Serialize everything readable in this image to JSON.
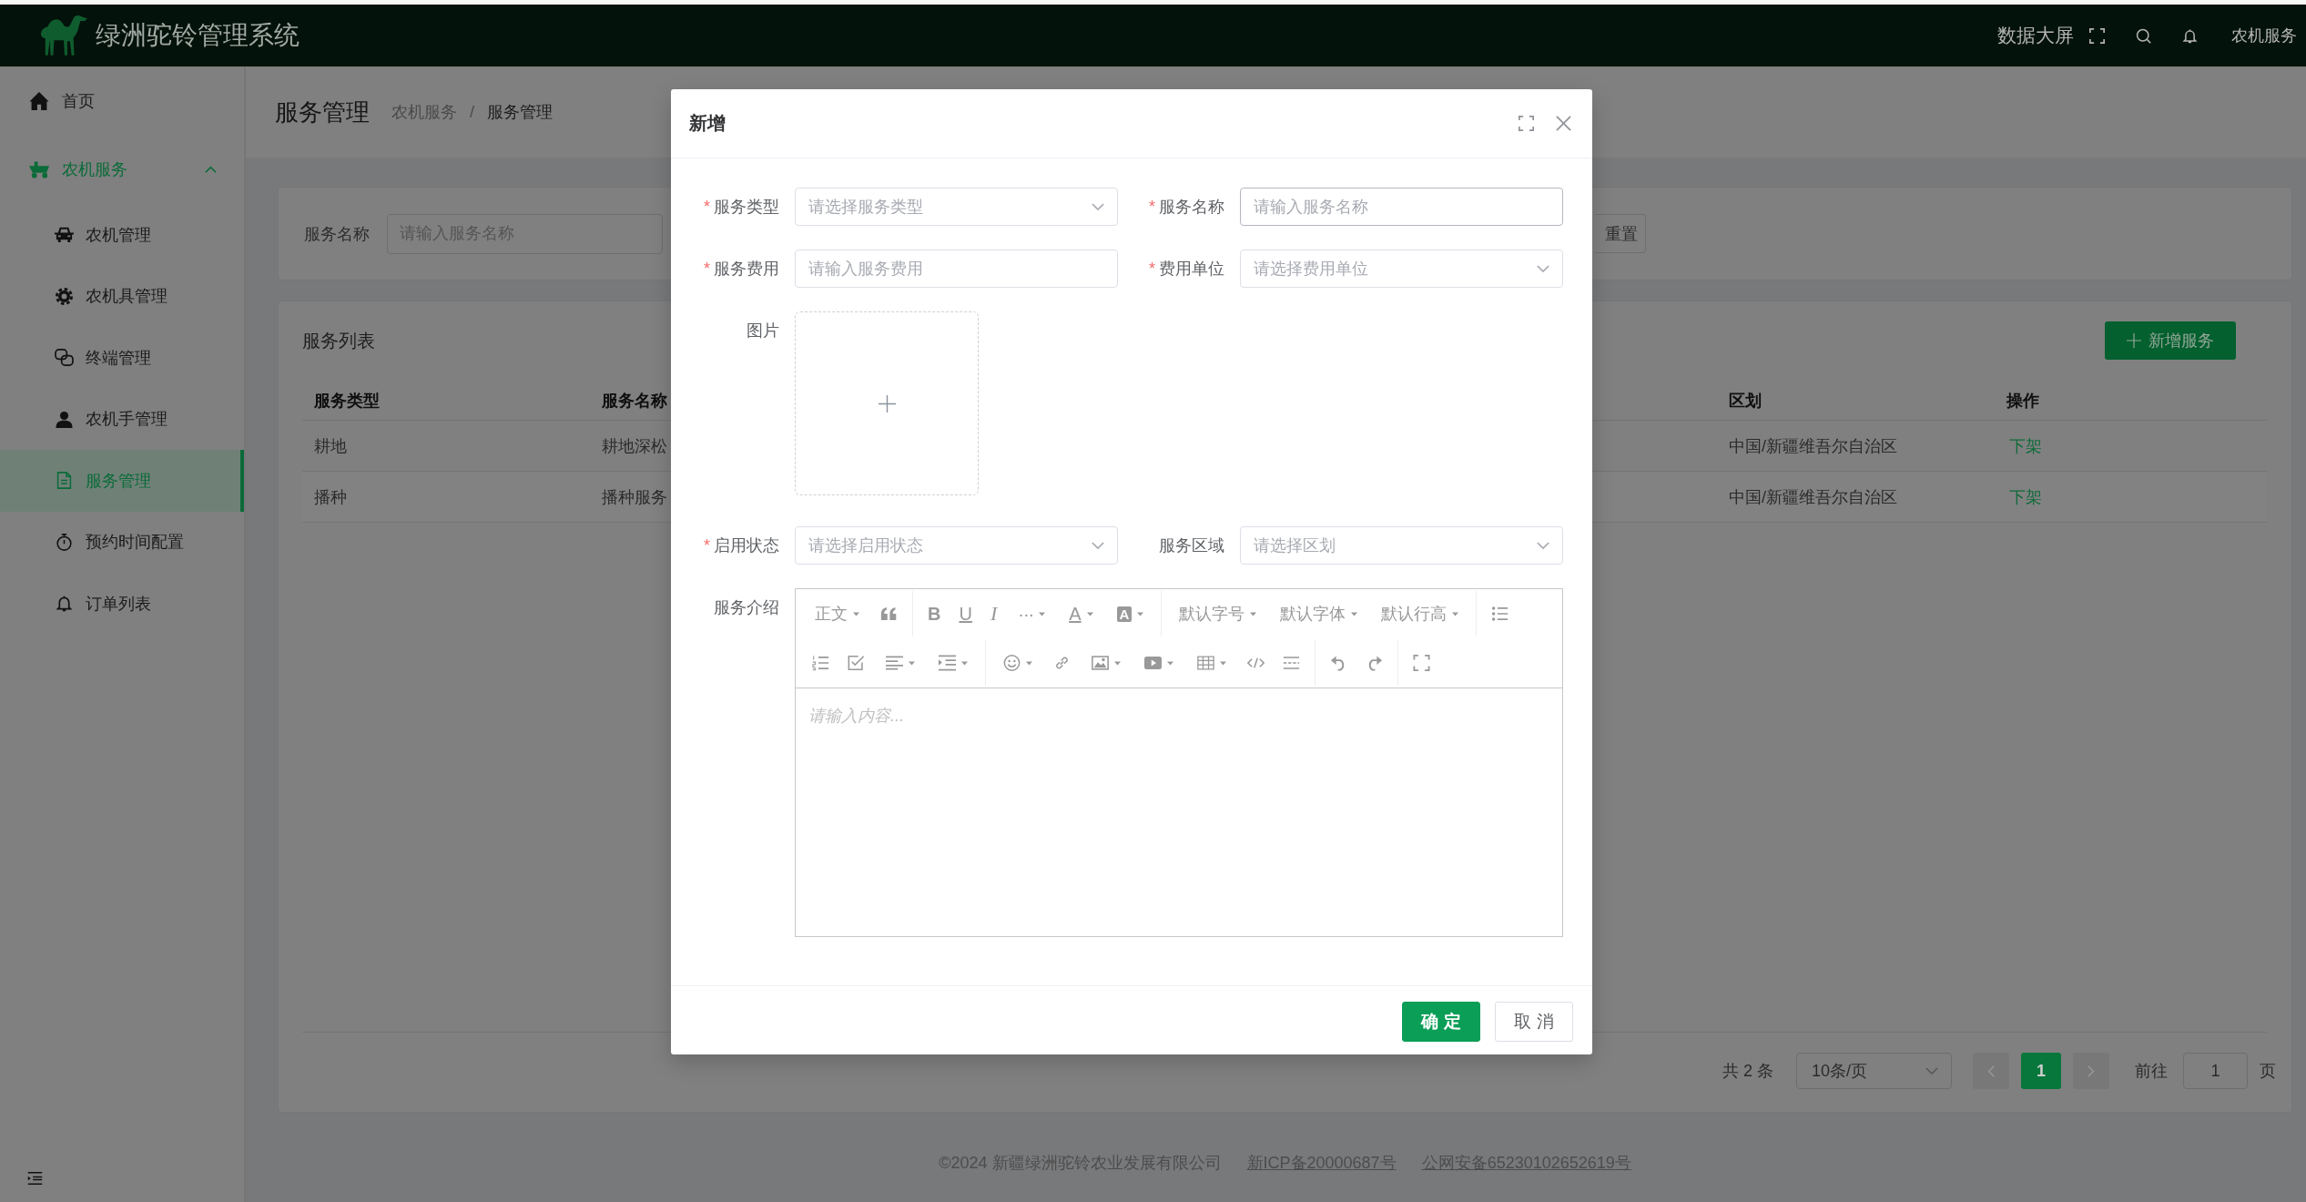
{
  "top_bar": {
    "title": "绿洲驼铃管理系统",
    "links": [
      "数据大屏"
    ],
    "user": "农机服务"
  },
  "sidebar": {
    "items": [
      {
        "label": "首页",
        "selected": false
      },
      {
        "label": "农机服务",
        "selected": false,
        "expanded": true,
        "children": [
          {
            "label": "农机管理",
            "selected": false
          },
          {
            "label": "农机具管理",
            "selected": false
          },
          {
            "label": "终端管理",
            "selected": false
          },
          {
            "label": "农机手管理",
            "selected": false
          },
          {
            "label": "服务管理",
            "selected": true
          },
          {
            "label": "预约时间配置",
            "selected": false
          },
          {
            "label": "订单列表",
            "selected": false
          }
        ]
      }
    ]
  },
  "page_header": {
    "title": "服务管理",
    "breadcrumb": [
      "农机服务",
      "服务管理"
    ],
    "separator": "/"
  },
  "search": {
    "label": "服务名称",
    "placeholder": "请输入服务名称",
    "reset_button": "重置"
  },
  "service_list": {
    "title": "服务列表",
    "add_button": "新增服务",
    "columns": [
      {
        "label": "服务类型",
        "kind": "text"
      },
      {
        "label": "服务名称",
        "kind": "text"
      },
      {
        "label": "区划",
        "kind": "text"
      },
      {
        "label": "操作",
        "kind": "link"
      }
    ],
    "rows": [
      {
        "cells": [
          "耕地",
          "耕地深松",
          "中国/新疆维吾尔自治区",
          "下架"
        ]
      },
      {
        "cells": [
          "播种",
          "播种服务",
          "中国/新疆维吾尔自治区",
          "下架"
        ]
      }
    ]
  },
  "pagination": {
    "total": "共 2 条",
    "page_size": "10条/页",
    "previous": {
      "disabled": true
    },
    "pages": [
      {
        "label": "1",
        "selected": true
      }
    ],
    "next": {
      "disabled": true
    },
    "jump_label": "前往",
    "jump_value": "1",
    "jump_suffix": "页"
  },
  "footer": {
    "copyright": "©2024 新疆绿洲驼铃农业发展有限公司",
    "links": [
      "新ICP备20000687号",
      "公网安备65230102652619号"
    ]
  },
  "dialog": {
    "title": "新增",
    "required_mark": "*",
    "fields": [
      {
        "label": "服务类型",
        "required": true,
        "kind": "select",
        "placeholder": "请选择服务类型",
        "hovered": false
      },
      {
        "label": "服务名称",
        "required": true,
        "kind": "input",
        "placeholder": "请输入服务名称",
        "hovered": true
      },
      {
        "label": "服务费用",
        "required": true,
        "kind": "input",
        "placeholder": "请输入服务费用",
        "hovered": false
      },
      {
        "label": "费用单位",
        "required": true,
        "kind": "select",
        "placeholder": "请选择费用单位",
        "hovered": false
      },
      {
        "label": "图片",
        "required": false,
        "kind": "upload",
        "hovered": false
      },
      {
        "label": "启用状态",
        "required": true,
        "kind": "select",
        "placeholder": "请选择启用状态",
        "hovered": false
      },
      {
        "label": "服务区域",
        "required": false,
        "kind": "select",
        "placeholder": "请选择区划",
        "hovered": false
      },
      {
        "label": "服务介绍",
        "required": false,
        "kind": "editor",
        "placeholder": "请输入内容...",
        "hovered": false,
        "toolbar": {
          "heading": "正文",
          "bold": "B",
          "underline": "U",
          "italic": "I",
          "more": "···",
          "font_color": "A",
          "background_color": "A",
          "font_size": "默认字号",
          "font_family": "默认字体",
          "line_height": "默认行高"
        }
      }
    ],
    "buttons": [
      {
        "label": "确 定",
        "kind": "primary"
      },
      {
        "label": "取 消",
        "kind": "default"
      }
    ]
  }
}
